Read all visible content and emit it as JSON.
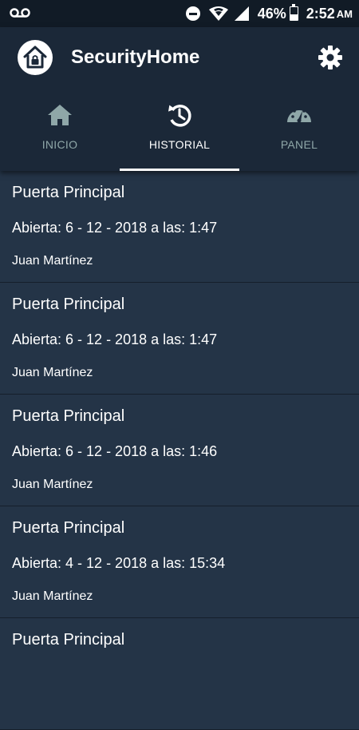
{
  "status_bar": {
    "battery": "46%",
    "battery_level": 0.46,
    "time": "2:52",
    "ampm": "AM"
  },
  "app_bar": {
    "title": "SecurityHome",
    "logo_icon": "home-lock-icon",
    "settings_icon": "gear-icon"
  },
  "tabs": [
    {
      "label": "INICIO",
      "icon": "home-icon",
      "active": false
    },
    {
      "label": "HISTORIAL",
      "icon": "history-icon",
      "active": true
    },
    {
      "label": "PANEL",
      "icon": "speedometer-icon",
      "active": false
    }
  ],
  "history": [
    {
      "title": "Puerta Principal",
      "detail": "Abierta: 6 - 12 - 2018 a las: 1:47",
      "user": "Juan Martínez"
    },
    {
      "title": "Puerta Principal",
      "detail": "Abierta: 6 - 12 - 2018 a las: 1:47",
      "user": "Juan Martínez"
    },
    {
      "title": "Puerta Principal",
      "detail": "Abierta: 6 - 12 - 2018 a las: 1:46",
      "user": "Juan Martínez"
    },
    {
      "title": "Puerta Principal",
      "detail": "Abierta: 4 - 12 - 2018 a las: 15:34",
      "user": "Juan Martínez"
    },
    {
      "title": "Puerta Principal",
      "detail": "",
      "user": ""
    }
  ],
  "colors": {
    "background": "#243447",
    "appbar": "#1b2838",
    "statusbar": "#111b26",
    "tab_inactive": "#8fa7a8",
    "accent": "#ffffff"
  }
}
